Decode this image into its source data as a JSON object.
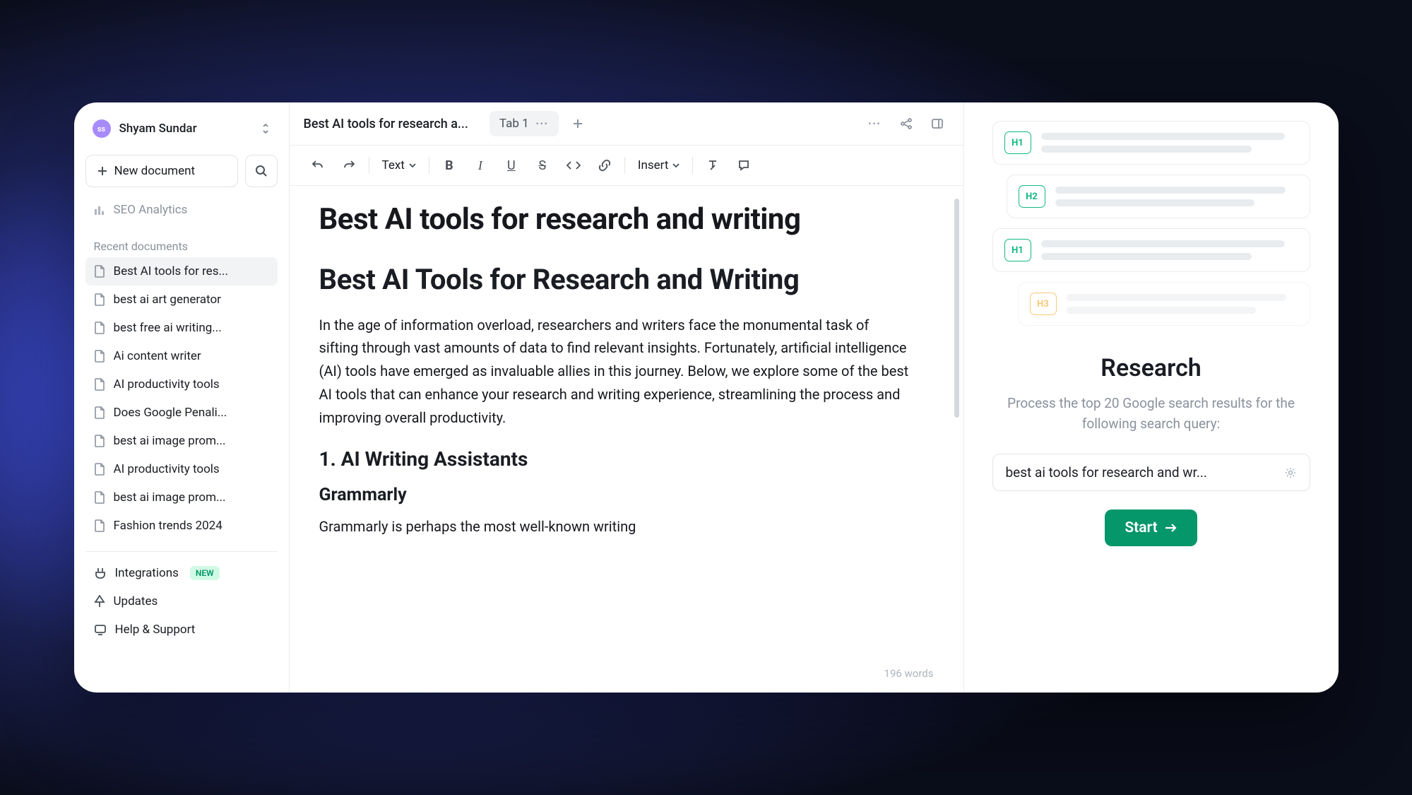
{
  "user": {
    "initials": "ss",
    "name": "Shyam Sundar"
  },
  "sidebar": {
    "newDoc": "New document",
    "clipped": "SEO Analytics",
    "recentLabel": "Recent documents",
    "docs": [
      "Best AI tools for res...",
      "best ai art generator",
      "best free ai writing...",
      "Ai content writer",
      "AI productivity tools",
      "Does Google Penali...",
      "best ai image prom...",
      "AI productivity tools",
      "best ai image prom...",
      "Fashion trends 2024"
    ],
    "footer": [
      {
        "label": "Integrations",
        "badge": "NEW"
      },
      {
        "label": "Updates"
      },
      {
        "label": "Help & Support"
      }
    ]
  },
  "tabs": {
    "docTitle": "Best AI tools for research a...",
    "tab1": "Tab 1"
  },
  "toolbar": {
    "text": "Text",
    "insert": "Insert"
  },
  "content": {
    "h1": "Best AI tools for research and writing",
    "h2": "Best AI Tools for Research and Writing",
    "p1": "In the age of information overload, researchers and writers face the monumental task of sifting through vast amounts of data to find relevant insights. Fortunately, artificial intelligence (AI) tools have emerged as invaluable allies in this journey. Below, we explore some of the best AI tools that can enhance your research and writing experience, streamlining the process and improving overall productivity.",
    "h3": "1. AI Writing Assistants",
    "h4": "Grammarly",
    "p2": "Grammarly is perhaps the most well-known writing",
    "wordCount": "196 words"
  },
  "research": {
    "title": "Research",
    "desc": "Process the top 20 Google search results for the following search query:",
    "query": "best ai tools for research and wr...",
    "start": "Start",
    "outline": [
      {
        "level": "H1",
        "indent": 0
      },
      {
        "level": "H2",
        "indent": 1
      },
      {
        "level": "H1",
        "indent": 0
      },
      {
        "level": "H3",
        "indent": 2,
        "orange": true
      }
    ]
  }
}
